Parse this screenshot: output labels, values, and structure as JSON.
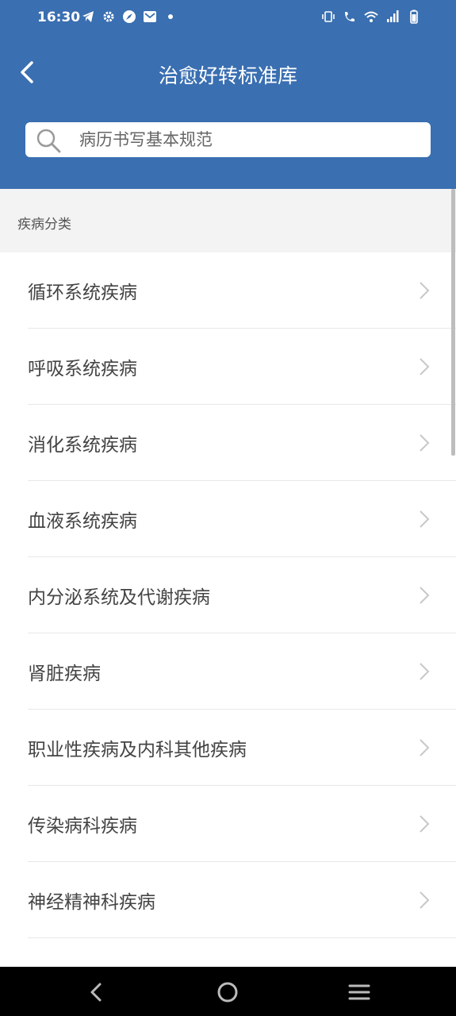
{
  "status": {
    "time": "16:30"
  },
  "header": {
    "title": "治愈好转标准库"
  },
  "search": {
    "placeholder": "病历书写基本规范"
  },
  "section": {
    "title": "疾病分类"
  },
  "categories": [
    {
      "label": "循环系统疾病"
    },
    {
      "label": "呼吸系统疾病"
    },
    {
      "label": "消化系统疾病"
    },
    {
      "label": "血液系统疾病"
    },
    {
      "label": "内分泌系统及代谢疾病"
    },
    {
      "label": "肾脏疾病"
    },
    {
      "label": "职业性疾病及内科其他疾病"
    },
    {
      "label": "传染病科疾病"
    },
    {
      "label": "神经精神科疾病"
    }
  ],
  "colors": {
    "primary": "#3a6fb1",
    "section_bg": "#f3f3f3",
    "text": "#444444"
  }
}
